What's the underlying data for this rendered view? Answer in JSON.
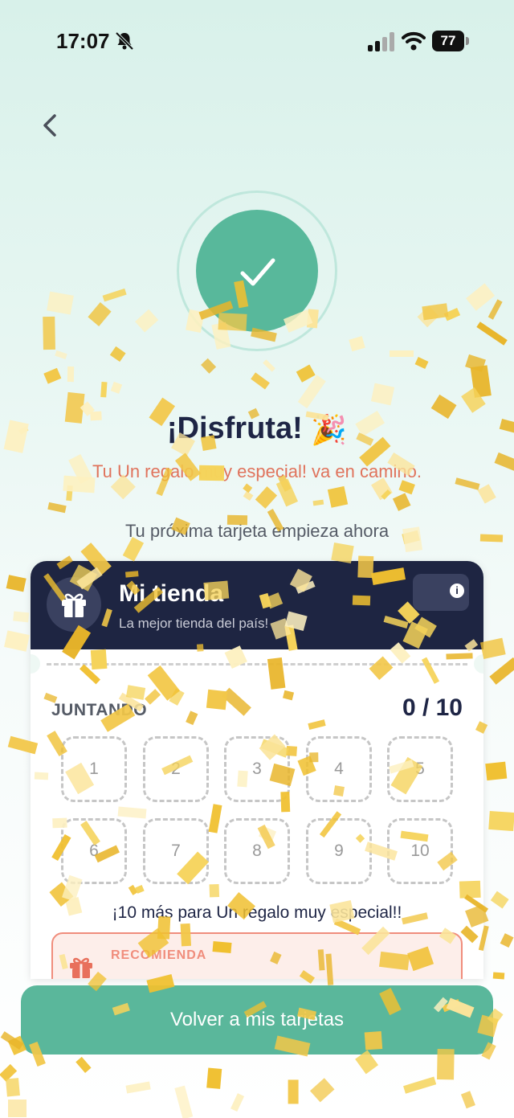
{
  "status_bar": {
    "time": "17:07",
    "battery": "77"
  },
  "header": {
    "title": "¡Disfruta!",
    "title_emoji": "🎉",
    "subtitle": "Tu Un regalo muy especial! va en camino.",
    "next_card_text": "Tu próxima tarjeta empieza ahora"
  },
  "card": {
    "store_name": "Mi tienda",
    "store_tagline": "La mejor tienda del país!",
    "info_glyph": "i",
    "progress_label": "JUNTANDO",
    "progress_count": "0 / 10",
    "progress_collected": 0,
    "progress_total": 10,
    "stamps": [
      "1",
      "2",
      "3",
      "4",
      "5",
      "6",
      "7",
      "8",
      "9",
      "10"
    ],
    "reward_text": "¡10 más para Un regalo muy especial!!",
    "recommend_label": "RECOMIENDA"
  },
  "footer": {
    "button_label": "Volver a mis tarjetas"
  },
  "colors": {
    "accent_green": "#58b89b",
    "navy": "#1e2542",
    "coral": "#e0735c",
    "confetti_gold": "#f0c030"
  },
  "icons": {
    "back": "chevron-left-icon",
    "success": "check-icon",
    "gift": "gift-icon",
    "info": "info-icon"
  }
}
